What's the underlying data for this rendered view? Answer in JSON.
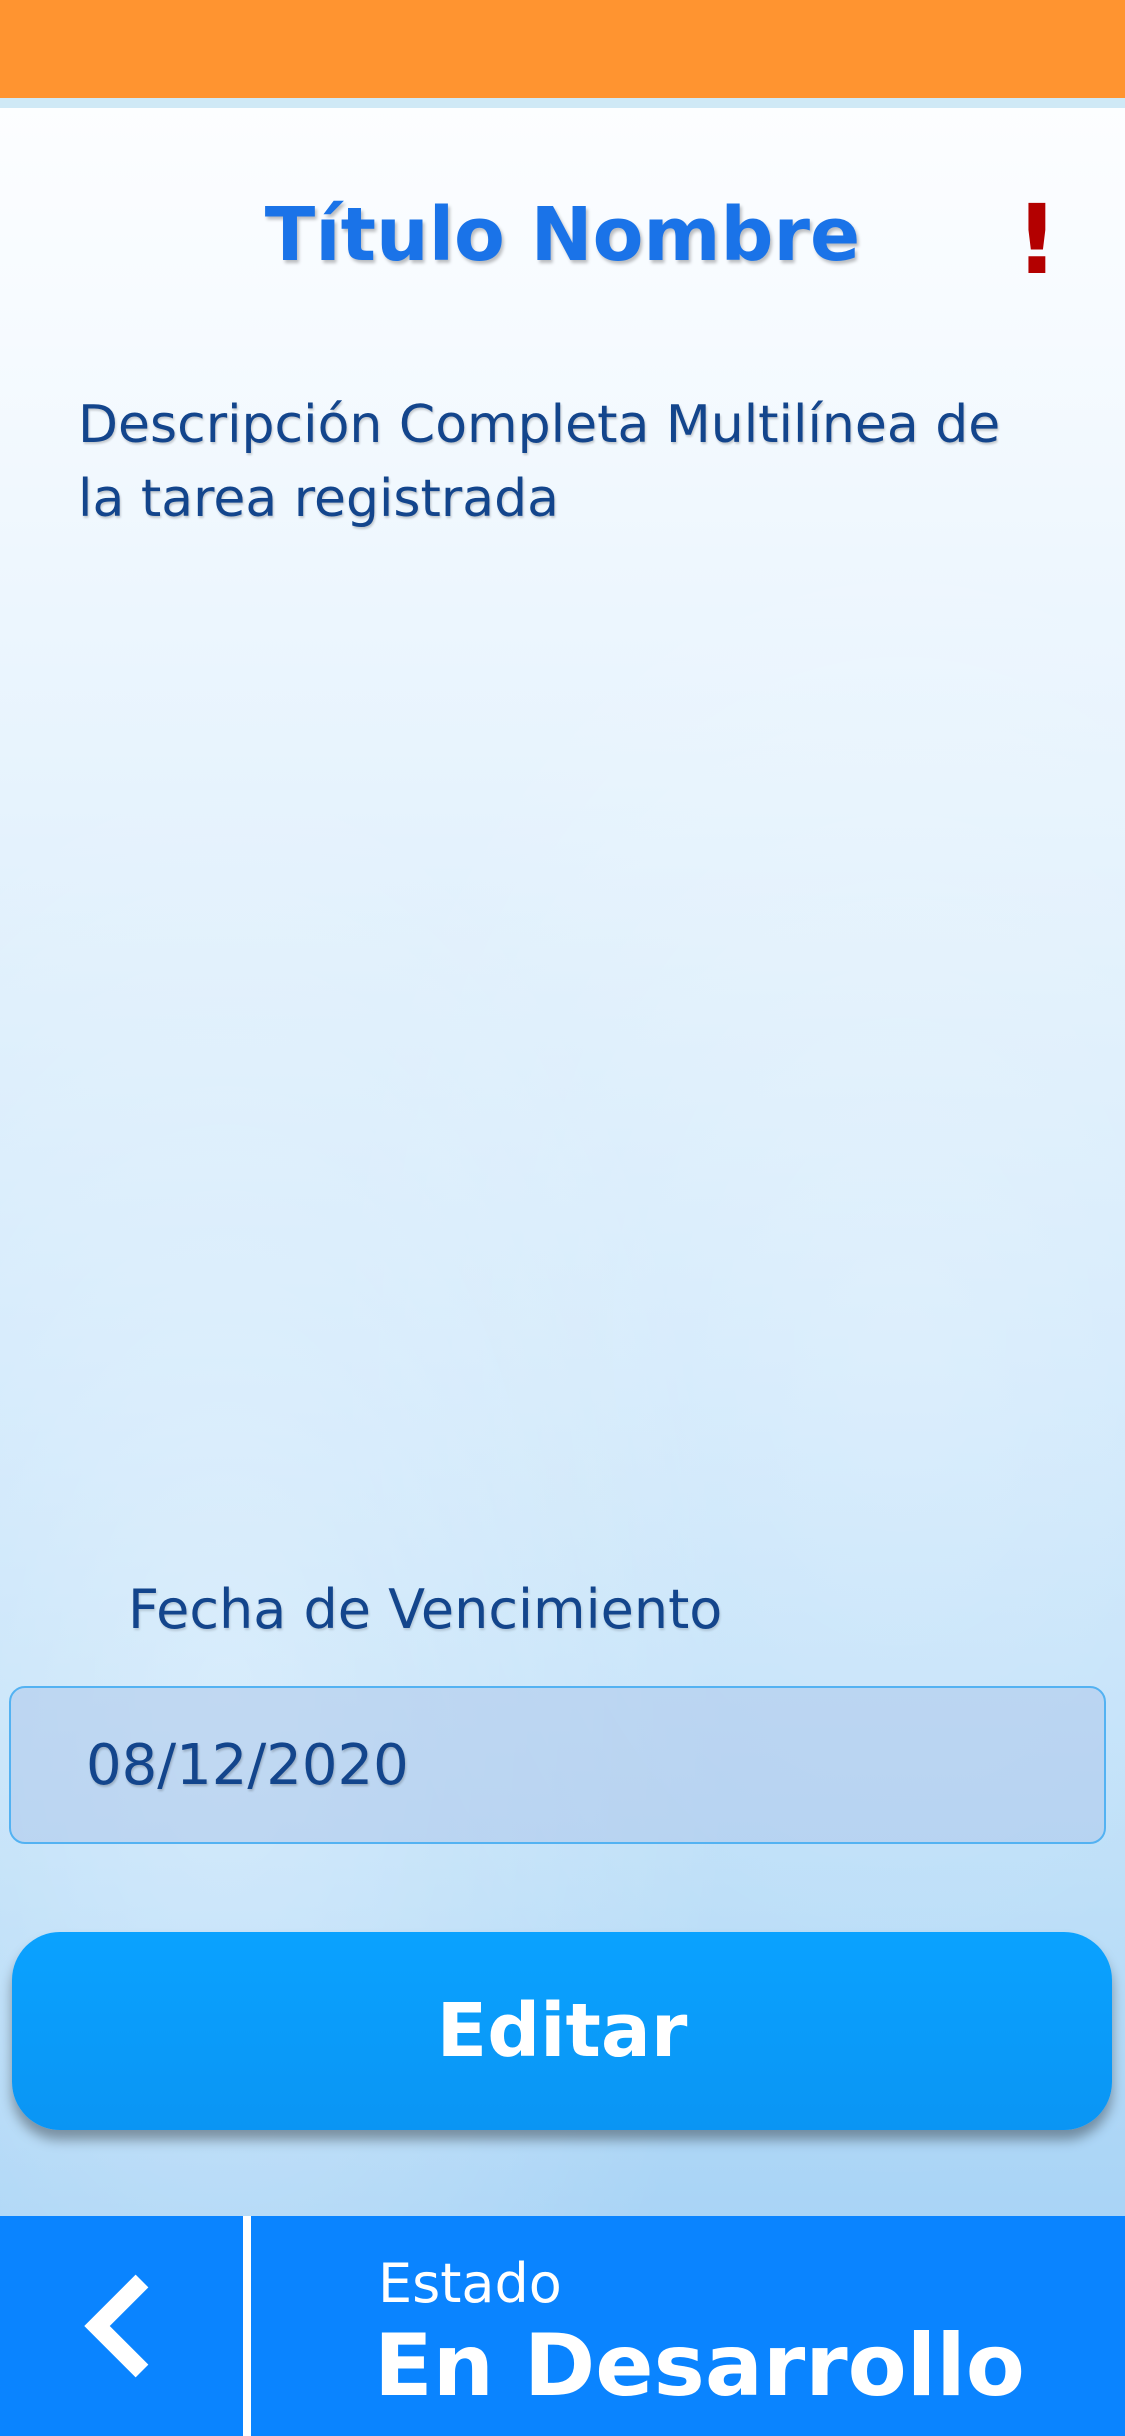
{
  "header": {
    "title": "Título Nombre",
    "priority_mark": "!"
  },
  "task": {
    "description": "Descripción Completa Multilínea de la tarea registrada",
    "due_label": "Fecha de Vencimiento",
    "due_date": "08/12/2020"
  },
  "actions": {
    "edit_label": "Editar"
  },
  "footer": {
    "back_icon": "chevron-left-icon",
    "status_label": "Estado",
    "status_value": "En Desarrollo"
  },
  "colors": {
    "status_bar": "#ff9430",
    "title": "#1a73e8",
    "priority": "#b30000",
    "button": "#0aa2ff",
    "bottom_bar": "#0a84ff"
  }
}
